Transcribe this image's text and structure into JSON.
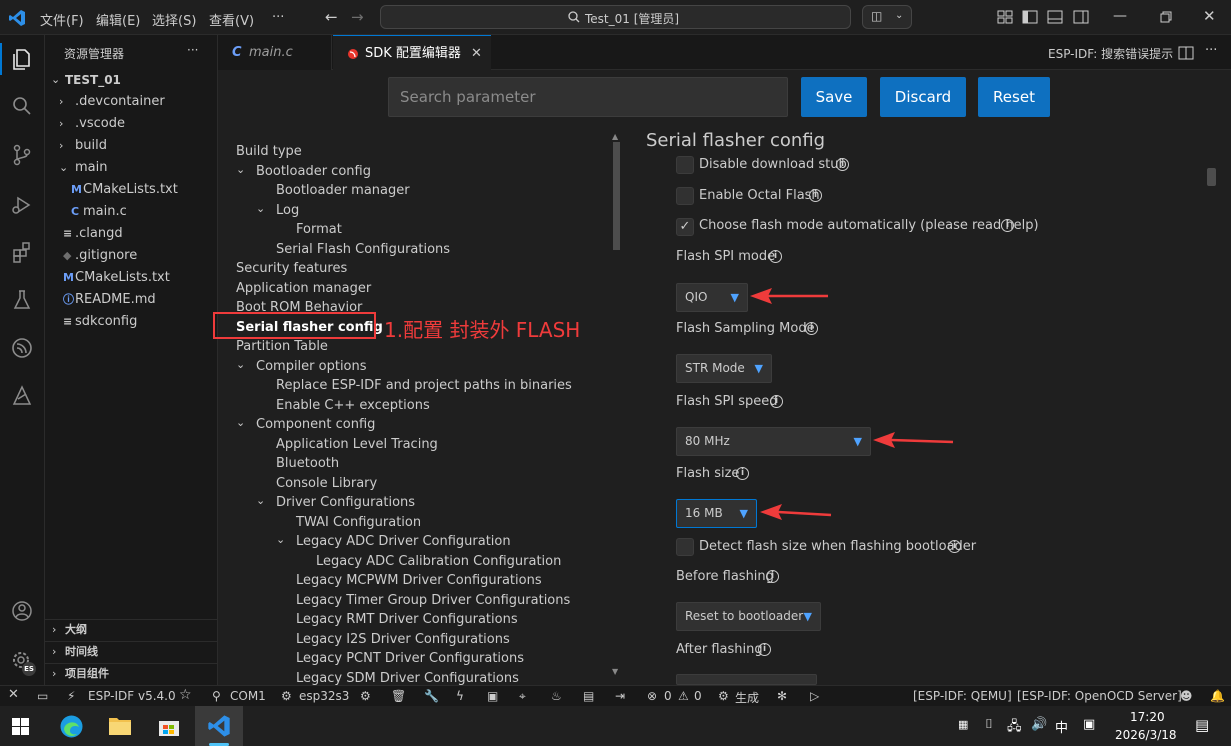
{
  "titlebar": {
    "menus": [
      "文件(F)",
      "编辑(E)",
      "选择(S)",
      "查看(V)",
      "···"
    ],
    "search_text": "Test_01 [管理员]"
  },
  "sidebar": {
    "title": "资源管理器",
    "more": "···",
    "root": "TEST_01",
    "items": [
      {
        "label": ".devcontainer",
        "type": "folder"
      },
      {
        "label": ".vscode",
        "type": "folder"
      },
      {
        "label": "build",
        "type": "folder"
      },
      {
        "label": "main",
        "type": "folder-open"
      },
      {
        "label": "CMakeLists.txt",
        "type": "cmake"
      },
      {
        "label": "main.c",
        "type": "c"
      },
      {
        "label": ".clangd",
        "type": "text"
      },
      {
        "label": ".gitignore",
        "type": "git"
      },
      {
        "label": "CMakeLists.txt",
        "type": "cmake"
      },
      {
        "label": "README.md",
        "type": "info"
      },
      {
        "label": "sdkconfig",
        "type": "text"
      }
    ],
    "bottom": [
      "大纲",
      "时间线",
      "项目组件"
    ]
  },
  "tabs": [
    {
      "label": "main.c",
      "icon": "C"
    },
    {
      "label": "SDK 配置编辑器",
      "active": true
    }
  ],
  "tabbar_right": "ESP-IDF:  搜索错误提示",
  "editor": {
    "search_placeholder": "Search parameter",
    "buttons": {
      "save": "Save",
      "discard": "Discard",
      "reset": "Reset"
    },
    "nav": [
      {
        "label": "Build type",
        "level": 0,
        "chev": ""
      },
      {
        "label": "Bootloader config",
        "level": 0,
        "chev": "v"
      },
      {
        "label": "Bootloader manager",
        "level": 1,
        "chev": ""
      },
      {
        "label": "Log",
        "level": 1,
        "chev": "v"
      },
      {
        "label": "Format",
        "level": 2,
        "chev": ""
      },
      {
        "label": "Serial Flash Configurations",
        "level": 1,
        "chev": ""
      },
      {
        "label": "Security features",
        "level": 0,
        "chev": ""
      },
      {
        "label": "Application manager",
        "level": 0,
        "chev": ""
      },
      {
        "label": "Boot ROM Behavior",
        "level": 0,
        "chev": ""
      },
      {
        "label": "Serial flasher config",
        "level": 0,
        "chev": "",
        "selected": true
      },
      {
        "label": "Partition Table",
        "level": 0,
        "chev": ""
      },
      {
        "label": "Compiler options",
        "level": 0,
        "chev": "v"
      },
      {
        "label": "Replace ESP-IDF and project paths in binaries",
        "level": 1,
        "chev": ""
      },
      {
        "label": "Enable C++ exceptions",
        "level": 1,
        "chev": ""
      },
      {
        "label": "Component config",
        "level": 0,
        "chev": "v"
      },
      {
        "label": "Application Level Tracing",
        "level": 1,
        "chev": ""
      },
      {
        "label": "Bluetooth",
        "level": 1,
        "chev": ""
      },
      {
        "label": "Console Library",
        "level": 1,
        "chev": ""
      },
      {
        "label": "Driver Configurations",
        "level": 1,
        "chev": "v"
      },
      {
        "label": "TWAI Configuration",
        "level": 2,
        "chev": ""
      },
      {
        "label": "Legacy ADC Driver Configuration",
        "level": 2,
        "chev": "v"
      },
      {
        "label": "Legacy ADC Calibration Configuration",
        "level": 3,
        "chev": ""
      },
      {
        "label": "Legacy MCPWM Driver Configurations",
        "level": 2,
        "chev": ""
      },
      {
        "label": "Legacy Timer Group Driver Configurations",
        "level": 2,
        "chev": ""
      },
      {
        "label": "Legacy RMT Driver Configurations",
        "level": 2,
        "chev": ""
      },
      {
        "label": "Legacy I2S Driver Configurations",
        "level": 2,
        "chev": ""
      },
      {
        "label": "Legacy PCNT Driver Configurations",
        "level": 2,
        "chev": ""
      },
      {
        "label": "Legacy SDM Driver Configurations",
        "level": 2,
        "chev": ""
      }
    ],
    "annotation": "1.配置 封装外 FLASH",
    "section_title": "Serial flasher config",
    "fields": {
      "disable_stub": "Disable download stub",
      "octal": "Enable Octal Flash",
      "auto_mode": "Choose flash mode automatically (please read help)",
      "spi_mode_label": "Flash SPI mode",
      "spi_mode_value": "QIO",
      "sampling_label": "Flash Sampling Mode",
      "sampling_value": "STR Mode",
      "speed_label": "Flash SPI speed",
      "speed_value": "80 MHz",
      "size_label": "Flash size",
      "size_value": "16 MB",
      "detect_size": "Detect flash size when flashing bootloader",
      "before_label": "Before flashing",
      "before_value": "Reset to bootloader",
      "after_label": "After flashing"
    }
  },
  "statusbar": {
    "idf": "ESP-IDF v5.4.0",
    "com": "COM1",
    "chip": "esp32s3",
    "errors": "0",
    "warnings": "0",
    "build": "生成",
    "qemu": "[ESP-IDF: QEMU]",
    "openocd": "[ESP-IDF: OpenOCD Server]"
  },
  "taskbar": {
    "ime": "中",
    "time": "17:20",
    "date": "2026/3/18"
  },
  "colors": {
    "accent": "#0e70c0",
    "annotation": "#ef3b3b"
  }
}
